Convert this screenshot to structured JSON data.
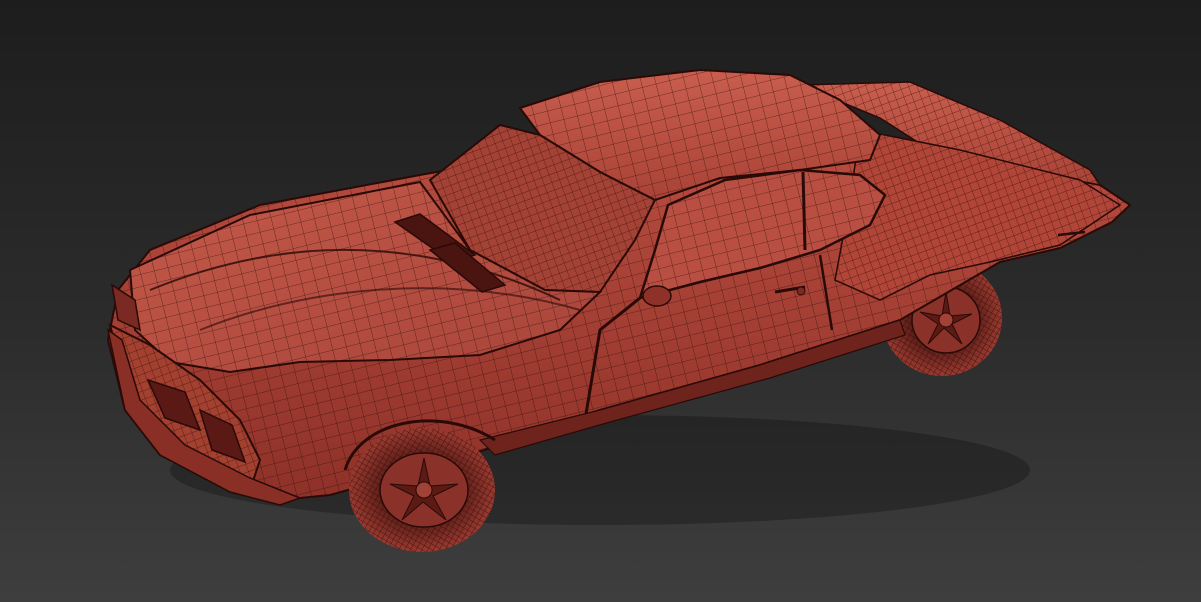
{
  "viewport": {
    "background_top": "#1d1d1d",
    "background_bottom": "#3e3e3e"
  },
  "model": {
    "body_color": "#b3483c",
    "body_light": "#c85a4b",
    "body_dark": "#7a2a22",
    "wire_color": "#2a0a07",
    "tire_color": "#7d2e27",
    "shading": "wireframe-over-shaded",
    "icon": "car-icon"
  }
}
